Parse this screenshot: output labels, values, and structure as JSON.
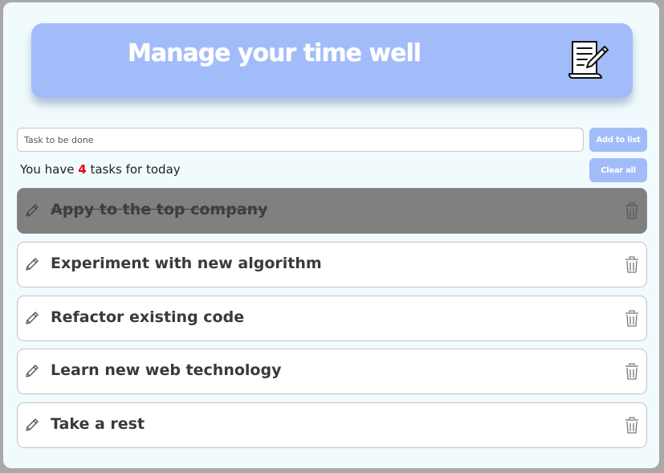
{
  "header": {
    "title": "Manage your time well",
    "icon": "notepad-pen-icon"
  },
  "task_input": {
    "value": "",
    "placeholder": "Task to be done"
  },
  "buttons": {
    "add_label": "Add to list",
    "clear_label": "Clear all"
  },
  "summary": {
    "prefix": "You have",
    "count": "4",
    "suffix": "tasks for today"
  },
  "tasks": [
    {
      "label": "Appy to the top company",
      "completed": true
    },
    {
      "label": "Experiment with new algorithm",
      "completed": false
    },
    {
      "label": "Refactor existing code",
      "completed": false
    },
    {
      "label": "Learn new web technology",
      "completed": false
    },
    {
      "label": "Take a rest",
      "completed": false
    }
  ],
  "colors": {
    "accent": "#a2bbf9",
    "background": "#f1fbfd",
    "completed_task": "#808080",
    "count_highlight": "#e8000b"
  }
}
